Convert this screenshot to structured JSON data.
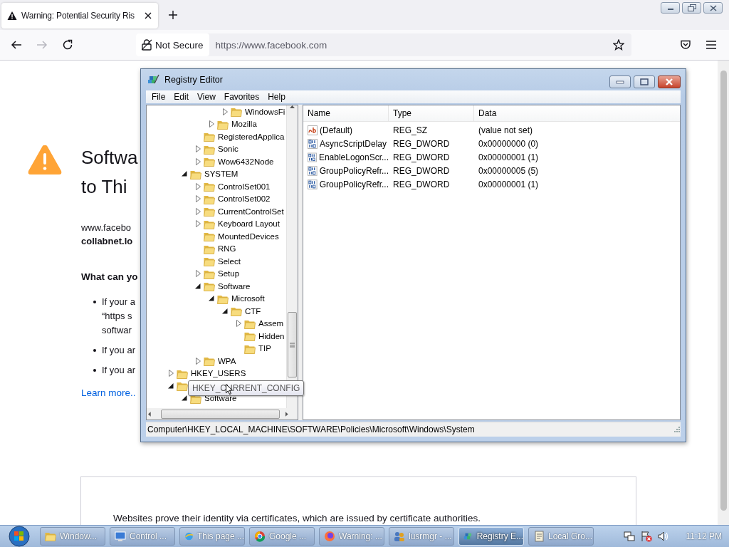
{
  "browser": {
    "tab": {
      "title": "Warning: Potential Security Ris",
      "selected": true
    },
    "forward_disabled": true,
    "site_identity": "Not Secure",
    "url": "https://www.facebook.com"
  },
  "error_page": {
    "heading_lines": [
      "Softwa",
      "to Thi"
    ],
    "intro": "www.facebo",
    "host": "collabnet.lo",
    "subheading": "What can yo",
    "bullets": [
      [
        "If your a",
        "“https s",
        "softwar"
      ],
      [
        "If you ar"
      ],
      [
        "If you ar"
      ]
    ],
    "link": "Learn more..",
    "details": "Websites prove their identity via certificates, which are issued by certificate authorities."
  },
  "registry_editor": {
    "title": "Registry Editor",
    "menu": [
      "File",
      "Edit",
      "View",
      "Favorites",
      "Help"
    ],
    "tree": [
      {
        "kind": "spacer",
        "children": [
          {
            "kind": "spacer",
            "children": [
              {
                "kind": "spacer",
                "children": [
                  {
                    "kind": "spacer",
                    "children": [
                      {
                        "kind": "branch",
                        "label": "WindowsFi",
                        "expanded": false
                      }
                    ]
                  },
                  {
                    "kind": "branch",
                    "label": "Mozilla",
                    "expanded": false
                  }
                ]
              },
              {
                "kind": "leaf",
                "label": "RegisteredApplica"
              },
              {
                "kind": "branch",
                "label": "Sonic",
                "expanded": false
              },
              {
                "kind": "branch",
                "label": "Wow6432Node",
                "expanded": false
              }
            ]
          },
          {
            "kind": "branch",
            "label": "SYSTEM",
            "expanded": true,
            "children": [
              {
                "kind": "branch",
                "label": "ControlSet001",
                "expanded": false
              },
              {
                "kind": "branch",
                "label": "ControlSet002",
                "expanded": false
              },
              {
                "kind": "branch",
                "label": "CurrentControlSet",
                "expanded": false
              },
              {
                "kind": "branch",
                "label": "Keyboard Layout",
                "expanded": false
              },
              {
                "kind": "leaf",
                "label": "MountedDevices"
              },
              {
                "kind": "leaf",
                "label": "RNG"
              },
              {
                "kind": "leaf",
                "label": "Select"
              },
              {
                "kind": "branch",
                "label": "Setup",
                "expanded": false
              },
              {
                "kind": "branch",
                "label": "Software",
                "expanded": true,
                "children": [
                  {
                    "kind": "branch",
                    "label": "Microsoft",
                    "expanded": true,
                    "children": [
                      {
                        "kind": "branch",
                        "label": "CTF",
                        "expanded": true,
                        "children": [
                          {
                            "kind": "branch",
                            "label": "Assem",
                            "expanded": false
                          },
                          {
                            "kind": "leaf",
                            "label": "Hidden"
                          },
                          {
                            "kind": "leaf",
                            "label": "TIP"
                          }
                        ]
                      }
                    ]
                  }
                ]
              },
              {
                "kind": "branch",
                "label": "WPA",
                "expanded": false
              }
            ]
          }
        ]
      },
      {
        "kind": "branch",
        "label": "HKEY_USERS",
        "expanded": false
      },
      {
        "kind": "branch",
        "expanded": true,
        "children": [
          {
            "kind": "branch",
            "label": "Software",
            "expanded": true
          }
        ]
      }
    ],
    "tooltip": "HKEY_CURRENT_CONFIG",
    "columns": [
      "Name",
      "Type",
      "Data"
    ],
    "values": [
      {
        "kind": "string",
        "name": "(Default)",
        "type": "REG_SZ",
        "data": "(value not set)"
      },
      {
        "kind": "binary",
        "name": "AsyncScriptDelay",
        "type": "REG_DWORD",
        "data": "0x00000000 (0)"
      },
      {
        "kind": "binary",
        "name": "EnableLogonScr...",
        "type": "REG_DWORD",
        "data": "0x00000001 (1)"
      },
      {
        "kind": "binary",
        "name": "GroupPolicyRefr...",
        "type": "REG_DWORD",
        "data": "0x00000005 (5)"
      },
      {
        "kind": "binary",
        "name": "GroupPolicyRefr...",
        "type": "REG_DWORD",
        "data": "0x00000001 (1)"
      }
    ],
    "status": "Computer\\HKEY_LOCAL_MACHINE\\SOFTWARE\\Policies\\Microsoft\\Windows\\System"
  },
  "taskbar": {
    "items": [
      {
        "kind": "folder",
        "label": "Window...",
        "selected": false
      },
      {
        "kind": "panel",
        "label": "Control ...",
        "selected": false
      },
      {
        "kind": "globe",
        "label": "This page ...",
        "selected": false
      },
      {
        "kind": "ring",
        "label": "Google ...",
        "selected": false
      },
      {
        "kind": "fox",
        "label": "Warning: ...",
        "selected": false
      },
      {
        "kind": "people",
        "label": "lusrmgr - ...",
        "selected": false
      },
      {
        "kind": "blocks",
        "label": "Registry E...",
        "selected": true
      },
      {
        "kind": "doc",
        "label": "Local Gro...",
        "selected": false
      }
    ],
    "clock": "11:12 PM"
  }
}
